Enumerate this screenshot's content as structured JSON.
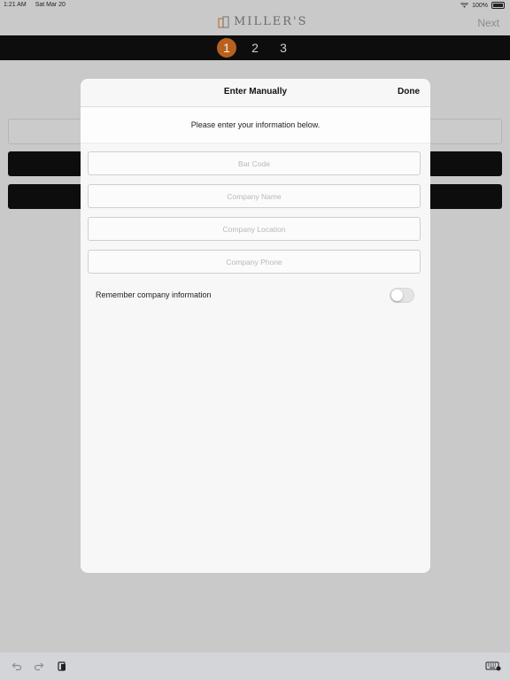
{
  "status_bar": {
    "time": "1:21 AM",
    "date": "Sat Mar 20",
    "battery": "100%"
  },
  "header": {
    "logo_text": "MILLER'S",
    "next_label": "Next"
  },
  "steps": [
    "1",
    "2",
    "3"
  ],
  "active_step": 1,
  "modal": {
    "title": "Enter Manually",
    "done_label": "Done",
    "subtitle": "Please enter your information below.",
    "fields": {
      "bar_code": {
        "placeholder": "Bar Code",
        "value": ""
      },
      "company_name": {
        "placeholder": "Company Name",
        "value": ""
      },
      "company_location": {
        "placeholder": "Company Location",
        "value": ""
      },
      "company_phone": {
        "placeholder": "Company Phone",
        "value": ""
      }
    },
    "remember_label": "Remember company information",
    "remember_on": false
  },
  "colors": {
    "accent": "#b8611e",
    "bar": "#0d0d0d"
  },
  "icons": [
    "wifi-icon",
    "battery-icon",
    "undo-icon",
    "redo-icon",
    "paste-icon",
    "keyboard-icon"
  ]
}
